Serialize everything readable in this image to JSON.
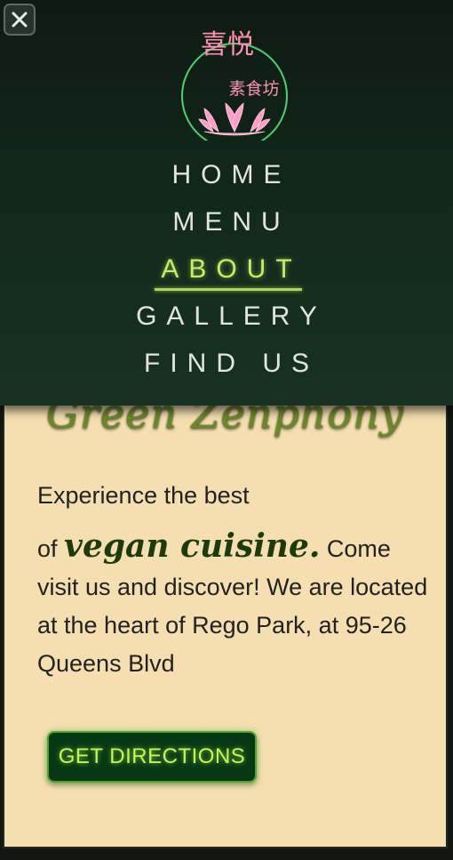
{
  "nav": {
    "close_icon": "close-icon",
    "logo": {
      "top_text": "喜悦",
      "sub_text": "素食坊",
      "icon": "lotus-icon",
      "ring_color": "#4fd06a",
      "text_color": "#ff8fb4"
    },
    "items": [
      {
        "label": "HOME",
        "active": false
      },
      {
        "label": "MENU",
        "active": false
      },
      {
        "label": "ABOUT",
        "active": true
      },
      {
        "label": "GALLERY",
        "active": false
      },
      {
        "label": "FIND US",
        "active": false
      }
    ]
  },
  "card": {
    "heading": "Green Zenphony",
    "line1": "Experience the best",
    "line2_pre": "of ",
    "line2_emph": "vegan cuisine.",
    "line2_post": " Come visit us and discover! We are located at the heart of Rego Park, at 95-26 Queens Blvd",
    "button_label": "GET DIRECTIONS"
  },
  "colors": {
    "card_bg": "#f5deb0",
    "accent_green": "#c7ec66",
    "button_bg": "#063814"
  }
}
